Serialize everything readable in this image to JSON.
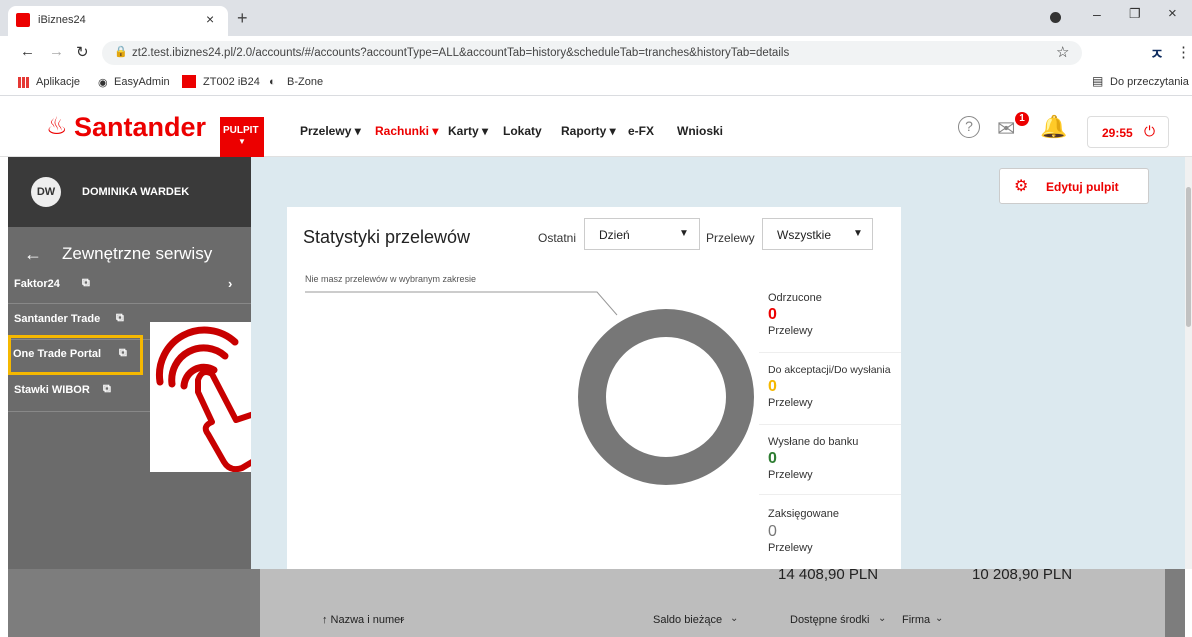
{
  "browser": {
    "tab_title": "iBiznes24",
    "url": "zt2.test.ibiznes24.pl/2.0/accounts/#/accounts?accountType=ALL&accountTab=history&scheduleTab=tranches&historyTab=details",
    "bookmarks": [
      "Aplikacje",
      "EasyAdmin",
      "ZT002 iB24",
      "B-Zone"
    ],
    "reading_list": "Do przeczytania"
  },
  "header": {
    "logo_text": "Santander",
    "pulpit_badge": "PULPIT",
    "nav": [
      {
        "label": "Przelewy ▾",
        "active": false
      },
      {
        "label": "Rachunki ▾",
        "active": true
      },
      {
        "label": "Karty ▾",
        "active": false
      },
      {
        "label": "Lokaty",
        "active": false
      },
      {
        "label": "Raporty ▾",
        "active": false
      },
      {
        "label": "e-FX",
        "active": false
      },
      {
        "label": "Wnioski",
        "active": false
      }
    ],
    "mail_badge": "1",
    "timer": "29:55"
  },
  "sidebar": {
    "avatar": "DW",
    "user_name": "DOMINIKA WARDEK",
    "section_title": "Zewnętrzne serwisy",
    "items": [
      "Faktor24",
      "Santander Trade",
      "One Trade Portal",
      "Stawki WIBOR"
    ]
  },
  "dashboard": {
    "edit_button": "Edytuj pulpit",
    "card_title": "Statystyki przelewów",
    "period_label": "Ostatni",
    "period_value": "Dzień",
    "type_label": "Przelewy",
    "type_value": "Wszystkie",
    "empty_note": "Nie masz przelewów w wybranym zakresie",
    "stats": [
      {
        "label": "Odrzucone",
        "value": "0",
        "unit": "Przelewy",
        "color": "#ec0000"
      },
      {
        "label": "Do akceptacji/Do wysłania",
        "value": "0",
        "unit": "Przelewy",
        "color": "#f5b800"
      },
      {
        "label": "Wysłane do banku",
        "value": "0",
        "unit": "Przelewy",
        "color": "#2e7d32"
      },
      {
        "label": "Zaksięgowane",
        "value": "0",
        "unit": "Przelewy",
        "color": "#777777"
      }
    ]
  },
  "accounts": {
    "balance1": "14 408,90 PLN",
    "balance2": "10 208,90 PLN",
    "col_name": "↑ Nazwa i numer",
    "col_balance": "Saldo bieżące",
    "col_available": "Dostępne środki",
    "col_company": "Firma"
  },
  "colors": {
    "brand": "#ec0000",
    "highlight": "#f5b800"
  }
}
